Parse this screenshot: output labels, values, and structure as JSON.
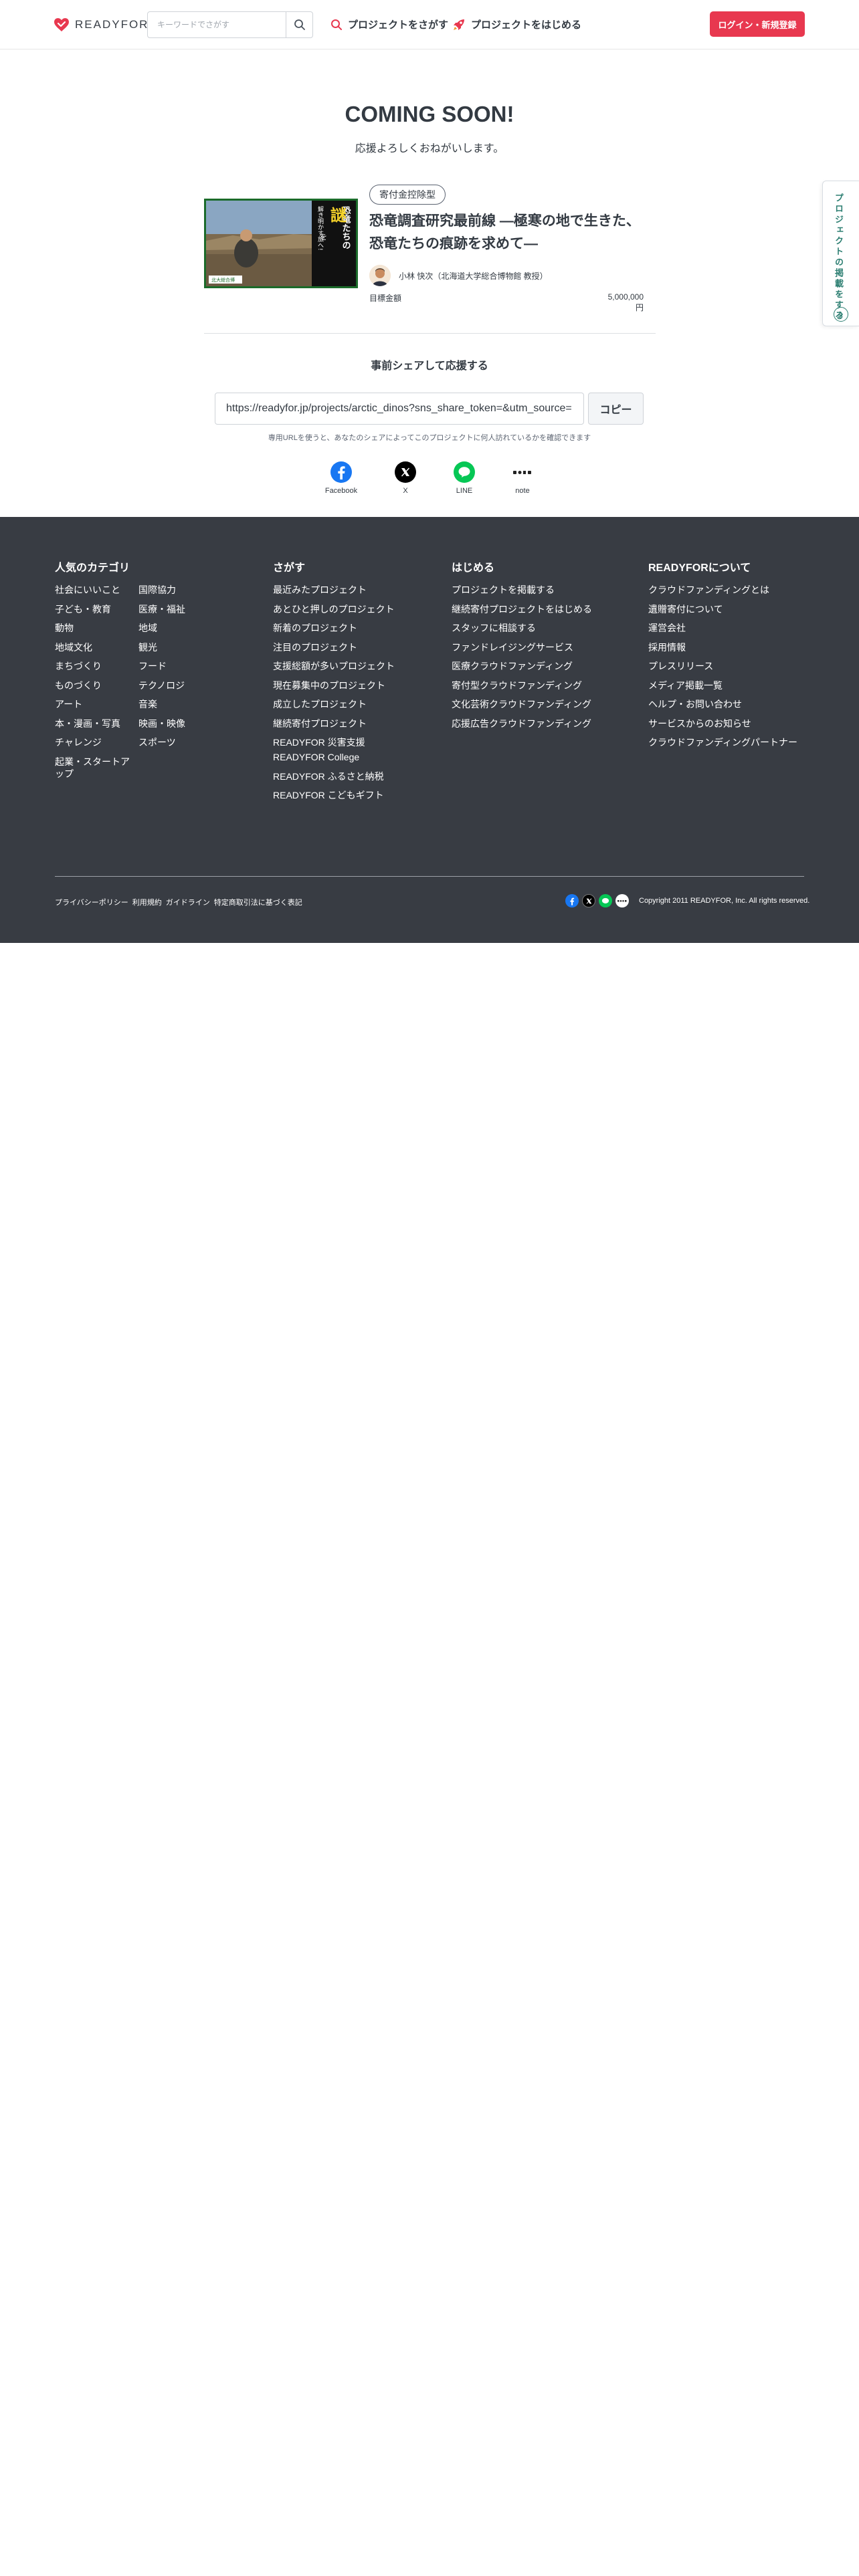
{
  "header": {
    "logo_text": "READYFOR",
    "search_placeholder": "キーワードでさがす",
    "nav_find": "プロジェクトをさがす",
    "nav_start": "プロジェクトをはじめる",
    "login_button": "ログイン・新規登録"
  },
  "side_tab": {
    "label": "プロジェクトの掲載をする"
  },
  "main": {
    "title": "COMING SOON!",
    "subtitle": "応援よろしくおねがいします。",
    "badge": "寄付金控除型",
    "project_title": "恐竜調査研究最前線 ―極寒の地で生きた、恐竜たちの痕跡を求めて―",
    "thumb_text_1": "恐竜たちの",
    "thumb_text_2": "謎",
    "thumb_text_3": "を",
    "thumb_text_4": "解き明かす旅へ!",
    "thumb_tag": "北大総合博",
    "owner": "小林 快次（北海道大学総合博物館 教授）",
    "target_label": "目標金額",
    "target_value": "5,000,000円"
  },
  "share": {
    "heading": "事前シェアして応援する",
    "url": "https://readyfor.jp/projects/arctic_dinos?sns_share_token=&utm_source=",
    "copy_button": "コピー",
    "note": "専用URLを使うと、あなたのシェアによってこのプロジェクトに何人訪れているかを確認できます",
    "facebook": "Facebook",
    "x": "X",
    "line": "LINE",
    "note_label": "note"
  },
  "footer": {
    "categories_heading": "人気のカテゴリ",
    "categories": [
      "社会にいいこと",
      "国際協力",
      "子ども・教育",
      "医療・福祉",
      "動物",
      "地域",
      "地域文化",
      "観光",
      "まちづくり",
      "フード",
      "ものづくり",
      "テクノロジ",
      "アート",
      "音楽",
      "本・漫画・写真",
      "映画・映像",
      "チャレンジ",
      "スポーツ",
      "起業・スタートアップ"
    ],
    "search_heading": "さがす",
    "search_links": [
      "最近みたプロジェクト",
      "あとひと押しのプロジェクト",
      "新着のプロジェクト",
      "注目のプロジェクト",
      "支援総額が多いプロジェクト",
      "現在募集中のプロジェクト",
      "成立したプロジェクト",
      "継続寄付プロジェクト",
      "READYFOR 災害支援",
      "READYFOR College",
      "READYFOR ふるさと納税",
      "READYFOR こどもギフト"
    ],
    "start_heading": "はじめる",
    "start_links": [
      "プロジェクトを掲載する",
      "継続寄付プロジェクトをはじめる",
      "スタッフに相談する",
      "ファンドレイジングサービス",
      "医療クラウドファンディング",
      "寄付型クラウドファンディング",
      "文化芸術クラウドファンディング",
      "応援広告クラウドファンディング"
    ],
    "about_heading": "READYFORについて",
    "about_links": [
      "クラウドファンディングとは",
      "遺贈寄付について",
      "運営会社",
      "採用情報",
      "プレスリリース",
      "メディア掲載一覧",
      "ヘルプ・お問い合わせ",
      "サービスからのお知らせ",
      "クラウドファンディングパートナー"
    ],
    "legal": [
      "プライバシーポリシー",
      "利用規約",
      "ガイドライン",
      "特定商取引法に基づく表記"
    ],
    "copyright": "Copyright 2011 READYFOR, Inc. All rights reserved."
  },
  "colors": {
    "brand_red": "#e8384f",
    "footer_bg": "#383c43",
    "side_tab_green": "#2d7f72",
    "facebook": "#1877f2",
    "line": "#06c755"
  }
}
